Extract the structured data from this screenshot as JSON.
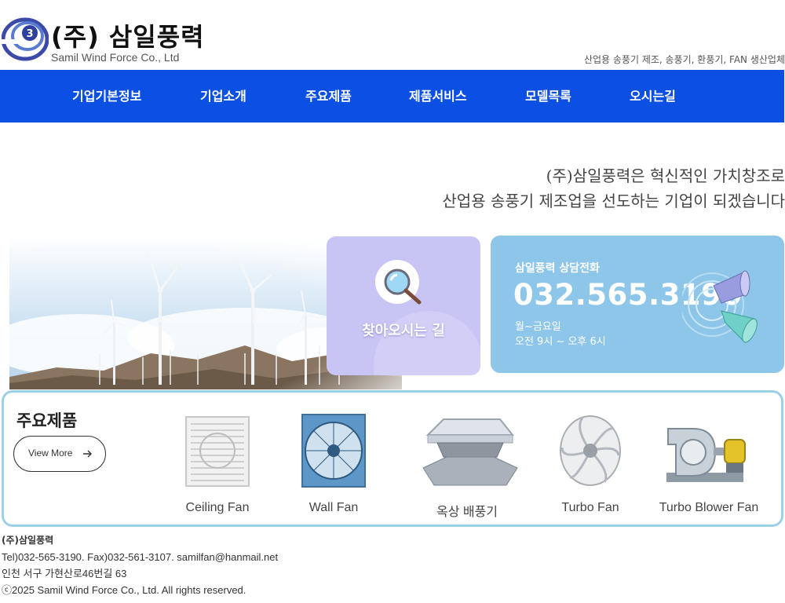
{
  "header": {
    "logo_title": "(주) 삼일풍력",
    "logo_subtitle": "Samil Wind Force Co., Ltd",
    "tagline": "산업용 송풍기 제조, 송풍기, 환풍기, FAN 생산업체"
  },
  "nav": {
    "items": [
      "기업기본정보",
      "기업소개",
      "주요제품",
      "제품서비스",
      "모델목록",
      "오시는길"
    ]
  },
  "slogan": {
    "line1": "(주)삼일풍력은 혁신적인 가치창조로",
    "line2": "산업용 송풍기 제조업을 선도하는 기업이 되겠습니다"
  },
  "find_card": {
    "label": "찾아오시는 길"
  },
  "call_card": {
    "title": "삼일풍력 상담전화",
    "phone": "032.565.3190",
    "days": "월~금요일",
    "hours": "오전 9시 ~ 오후 6시"
  },
  "products": {
    "heading": "주요제품",
    "view_more": "View More",
    "items": [
      {
        "name": "Ceiling Fan"
      },
      {
        "name": "Wall Fan"
      },
      {
        "name": "옥상 배풍기"
      },
      {
        "name": "Turbo Fan"
      },
      {
        "name": "Turbo Blower Fan"
      }
    ]
  },
  "footer": {
    "company": "(주)삼일풍력",
    "contact": "Tel)032-565-3190. Fax)032-561-3107. samilfan@hanmail.net",
    "address": "인천 서구 가현산로46번길 63",
    "copyright": "ⓒ2025 Samil Wind Force Co., Ltd. All rights reserved."
  },
  "colors": {
    "nav_bg": "#0b4fe3",
    "find_card_bg": "#c8c4f4",
    "call_card_bg": "#8ec6ea",
    "products_border": "#9ccfea"
  }
}
